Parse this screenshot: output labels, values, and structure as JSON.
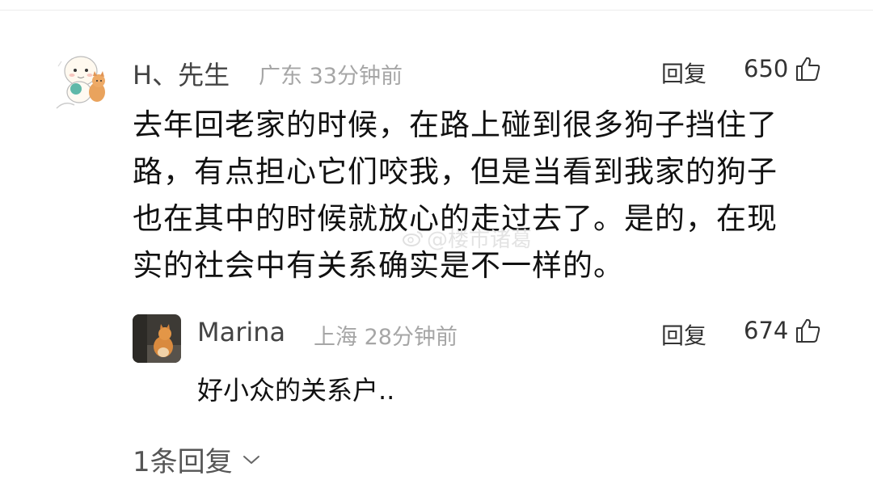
{
  "comment": {
    "username": "H、先生",
    "location": "广东",
    "time": "33分钟前",
    "reply_label": "回复",
    "likes": "650",
    "lines": [
      "去年回老家的时候，在路上碰到很多狗子挡住了",
      "路，有点担心它们咬我，但是当看到我家的狗子",
      "也在其中的时候就放心的走过去了。是的，在现",
      "实的社会中有关系确实是不一样的。"
    ]
  },
  "reply": {
    "username": "Marina",
    "location": "上海",
    "time": "28分钟前",
    "reply_label": "回复",
    "likes": "674",
    "text": "好小众的关系户.."
  },
  "replies_toggle": {
    "label": "1条回复"
  },
  "watermark": {
    "text": "@楼市诸葛"
  },
  "colors": {
    "text_primary": "#111111",
    "text_secondary": "#a6a6a6",
    "username": "#444444"
  },
  "icons": {
    "like": "thumbs-up-icon",
    "expand": "chevron-down-icon"
  }
}
